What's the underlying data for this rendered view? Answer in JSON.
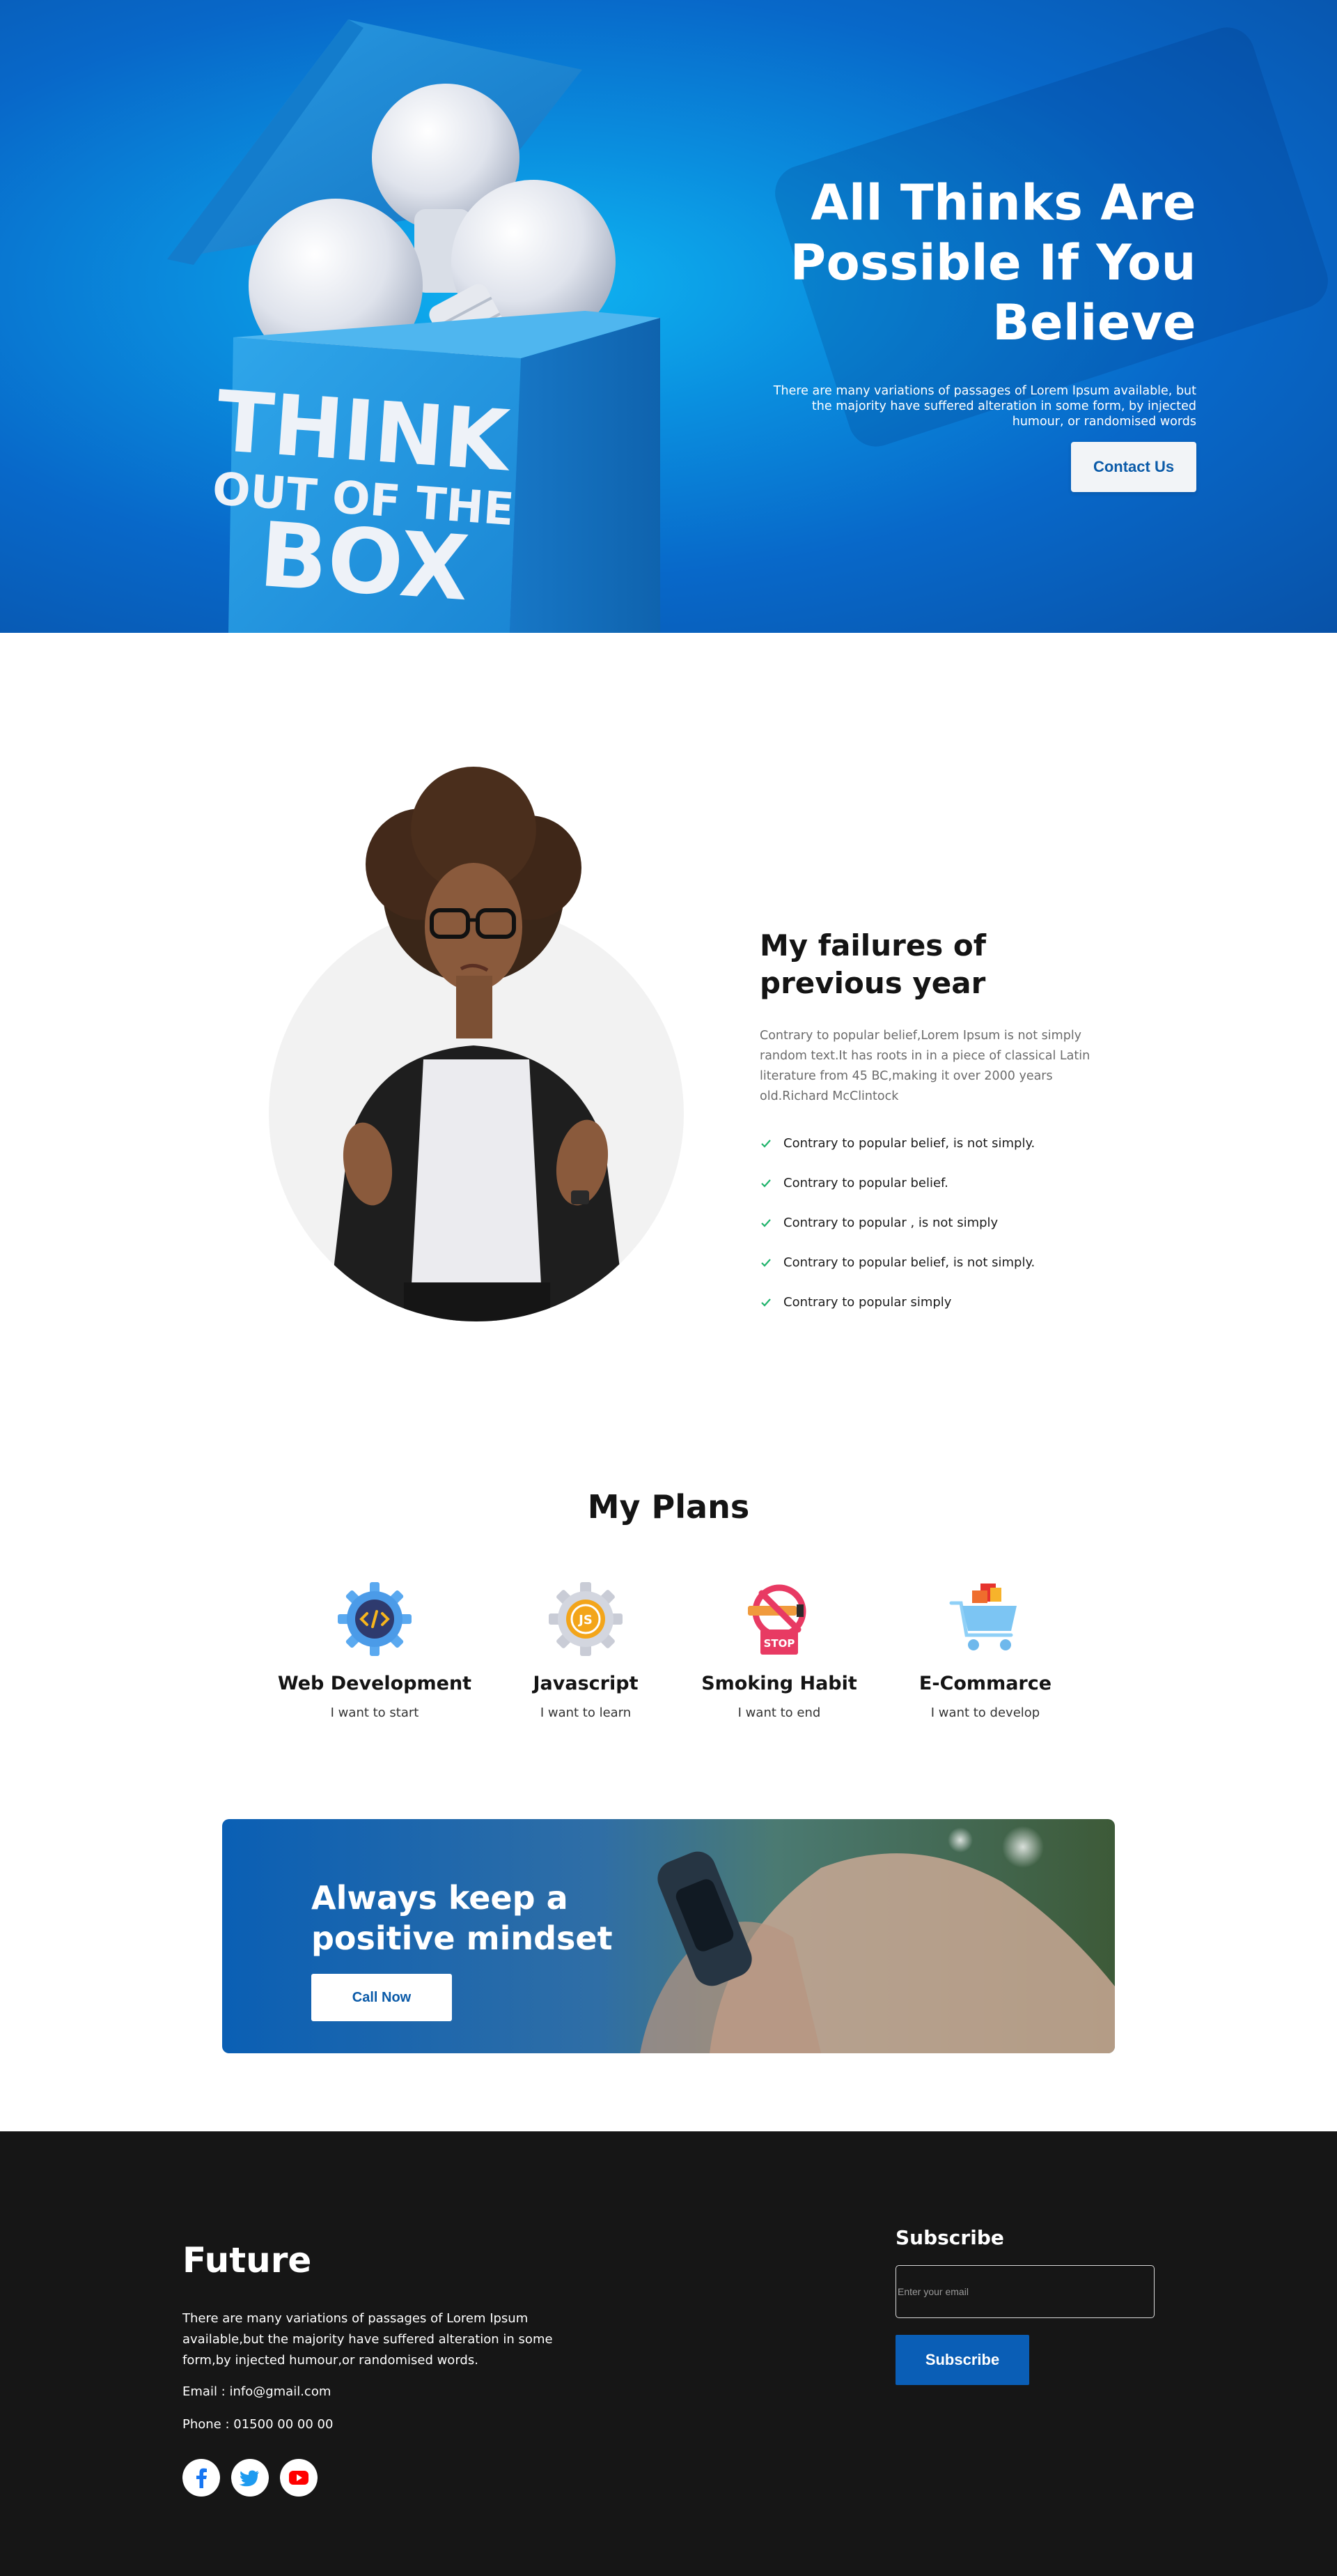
{
  "hero": {
    "title": "All Thinks Are Possible If You Believe",
    "subtitle": "There are many variations of passages of Lorem Ipsum available, but the majority have suffered alteration in some form, by injected humour, or randomised words",
    "cta_label": "Contact Us",
    "box_text": {
      "line1": "THINK",
      "line2": "OUT OF THE",
      "line3": "BOX"
    }
  },
  "failures": {
    "title": "My failures of previous year",
    "paragraph": "Contrary to popular belief,Lorem Ipsum is not simply random text.It has roots in in a piece of classical Latin literature from 45 BC,making it over 2000 years old.Richard McClintock",
    "items": [
      "Contrary to popular belief, is not simply.",
      "Contrary to popular belief.",
      "Contrary to popular , is not simply",
      "Contrary to popular belief, is not simply.",
      "Contrary to popular simply"
    ]
  },
  "plans": {
    "title": "My Plans",
    "items": [
      {
        "name": "Web Development",
        "desc": "I want to start",
        "icon": "code-gear-icon"
      },
      {
        "name": "Javascript",
        "desc": "I want to learn",
        "icon": "javascript-gear-icon"
      },
      {
        "name": "Smoking Habit",
        "desc": "I want to end",
        "icon": "no-smoking-icon",
        "badge": "STOP"
      },
      {
        "name": "E-Commarce",
        "desc": "I want to develop",
        "icon": "shopping-cart-icon"
      }
    ]
  },
  "cta": {
    "title": "Always keep a positive mindset",
    "button_label": "Call Now"
  },
  "footer": {
    "brand": "Future",
    "description": "There are many variations of passages of Lorem Ipsum available,but the majority have suffered alteration in some form,by injected humour,or randomised words.",
    "email": "Email : info@gmail.com",
    "phone": "Phone : 01500 00 00 00",
    "social": [
      "facebook-icon",
      "twitter-icon",
      "youtube-icon"
    ],
    "subscribe": {
      "title": "Subscribe",
      "placeholder": "Enter your email",
      "button_label": "Subscribe"
    }
  },
  "colors": {
    "primary": "#0a5eb6",
    "hero_light": "#0fb5f2",
    "check": "#1fb36b",
    "footer_bg": "#161616"
  }
}
